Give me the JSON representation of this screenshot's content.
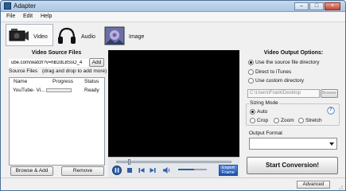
{
  "window": {
    "title": "Adapter",
    "minimize": "–",
    "maximize": "□",
    "close": "×"
  },
  "menu": [
    "File",
    "Edit",
    "Help"
  ],
  "tabs": [
    {
      "label": "Video",
      "icon": "video-camera-icon",
      "active": true
    },
    {
      "label": "Audio",
      "icon": "headphones-icon",
      "active": false
    },
    {
      "label": "Image",
      "icon": "image-icon",
      "active": false
    }
  ],
  "left_panel": {
    "title": "Video Source Files",
    "url_value": "ube.com/watch?v=hB2dL8SsO_4",
    "add_label": "Add",
    "source_files_label": "Source Files",
    "hint": "(drag and drop to add more)",
    "columns": [
      "Name",
      "Progress",
      "Status"
    ],
    "rows": [
      {
        "name": "YouTube- Vi...",
        "progress": 0,
        "status": "Ready"
      }
    ],
    "browse_add_label": "Browse & Add",
    "remove_label": "Remove"
  },
  "player": {
    "export_label": "Export Frame",
    "seek": 0.1,
    "volume": 0.55
  },
  "output": {
    "title": "Video Output Options:",
    "radio_source": "Use the source file directory",
    "radio_itunes": "Direct to iTunes",
    "radio_custom": "Use custom directory",
    "directory_value": "C:\\Users\\Frank\\Desktop",
    "browse_label": "Browse",
    "sizing_mode_label": "Sizing Mode",
    "sizing_auto": "Auto",
    "sizing_crop": "Crop",
    "sizing_zoom": "Zoom",
    "sizing_stretch": "Stretch",
    "help_label": "?",
    "output_format_label": "Output Format",
    "output_format_value": "",
    "start_label": "Start Conversion!",
    "advanced_label": "Advanced"
  }
}
